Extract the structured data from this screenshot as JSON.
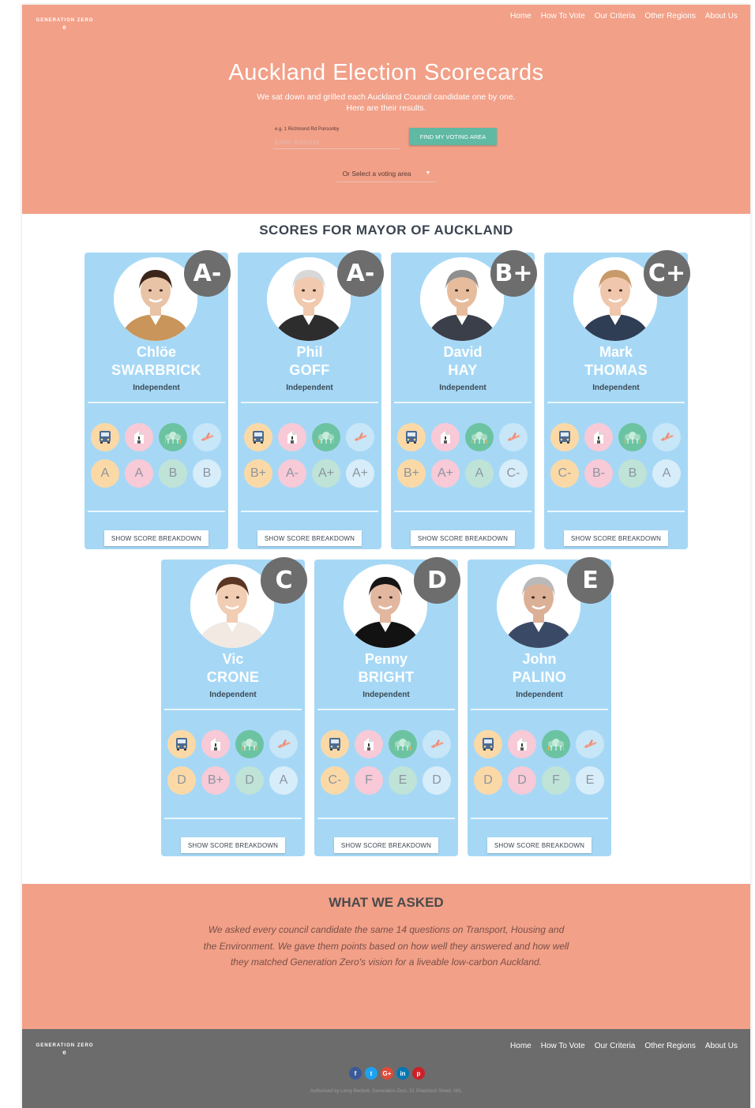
{
  "brand": {
    "name": "GENERATION ZERO",
    "mark": "e"
  },
  "nav": [
    "Home",
    "How To Vote",
    "Our Criteria",
    "Other Regions",
    "About Us"
  ],
  "hero": {
    "title": "Auckland Election Scorecards",
    "subtitle_1": "We sat down and grilled each Auckland Council candidate one by one.",
    "subtitle_2": "Here are their results.",
    "address_hint": "e.g. 1 Richmond Rd Ponsonby",
    "address_placeholder": "Enter Address",
    "find_button": "FIND MY VOTING AREA",
    "area_select": "Or Select a voting area"
  },
  "scores_title": "SCORES FOR MAYOR OF AUCKLAND",
  "category_icons": [
    "bus-icon",
    "house-icon",
    "tree-icon",
    "plane-icon"
  ],
  "breakdown_label": "SHOW SCORE BREAKDOWN",
  "candidates": [
    {
      "first": "Chlöe",
      "last": "SWARBRICK",
      "party": "Independent",
      "overall": "A-",
      "grades": [
        "A",
        "A",
        "B",
        "B"
      ]
    },
    {
      "first": "Phil",
      "last": "GOFF",
      "party": "Independent",
      "overall": "A-",
      "grades": [
        "B+",
        "A-",
        "A+",
        "A+"
      ]
    },
    {
      "first": "David",
      "last": "HAY",
      "party": "Independent",
      "overall": "B+",
      "grades": [
        "B+",
        "A+",
        "A",
        "C-"
      ]
    },
    {
      "first": "Mark",
      "last": "THOMAS",
      "party": "Independent",
      "overall": "C+",
      "grades": [
        "C-",
        "B-",
        "B",
        "A"
      ]
    },
    {
      "first": "Vic",
      "last": "CRONE",
      "party": "Independent",
      "overall": "C",
      "grades": [
        "D",
        "B+",
        "D",
        "A"
      ]
    },
    {
      "first": "Penny",
      "last": "BRIGHT",
      "party": "Independent",
      "overall": "D",
      "grades": [
        "C-",
        "F",
        "E",
        "D"
      ]
    },
    {
      "first": "John",
      "last": "PALINO",
      "party": "Independent",
      "overall": "E",
      "grades": [
        "D",
        "D",
        "F",
        "E"
      ]
    }
  ],
  "asked": {
    "title": "WHAT WE ASKED",
    "body": "We asked every council candidate the same 14 questions on Transport, Housing and the Environment. We gave them points based on how well they answered and how well they matched Generation Zero's vision for a liveable low-carbon Auckland."
  },
  "footer": {
    "social": [
      {
        "icon": "facebook-icon",
        "glyph": "f",
        "color": "#3b5998"
      },
      {
        "icon": "twitter-icon",
        "glyph": "t",
        "color": "#1da1f2"
      },
      {
        "icon": "google-plus-icon",
        "glyph": "G+",
        "color": "#dd4b39"
      },
      {
        "icon": "linkedin-icon",
        "glyph": "in",
        "color": "#0077b5"
      },
      {
        "icon": "pinterest-icon",
        "glyph": "p",
        "color": "#cb2027"
      }
    ],
    "authorised": "Authorised by Leroy Beckett, Generation Zero, 31 Shaddock Street, AKL"
  },
  "colors": {
    "hero": "#f2a088",
    "card": "#a6d8f6",
    "badge": "#6d6d6d",
    "footer": "#6c6c6c",
    "button": "#5fb9a3"
  }
}
